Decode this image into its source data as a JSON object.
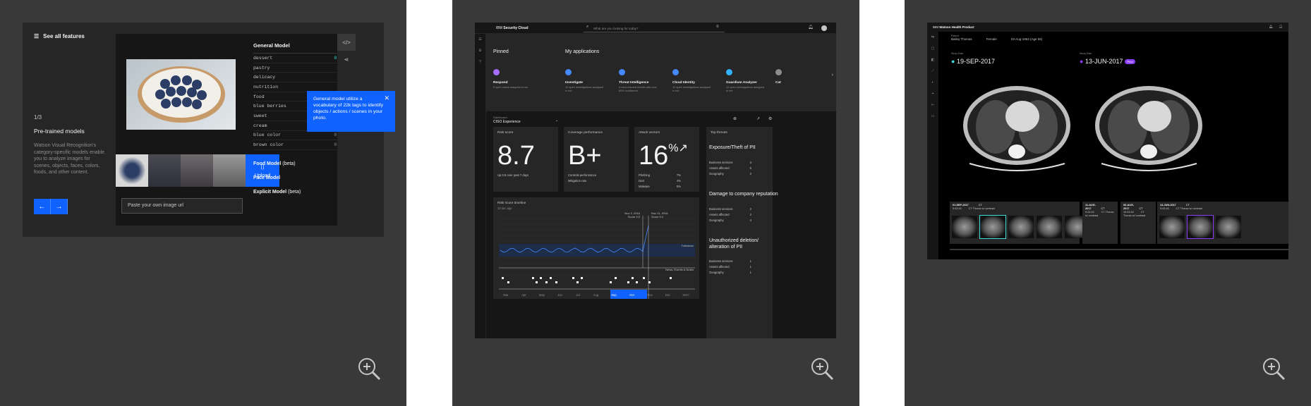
{
  "pane1": {
    "see_all": "See all features",
    "counter": "1/3",
    "title": "Pre-trained models",
    "description": "Watson Visual Recognition's category-specific models enable you to analyze images for scenes, objects, faces, colors, foods, and other content.",
    "upload_label": "Upload",
    "url_placeholder": "Paste your own image url",
    "general_model": "General Model",
    "tags": [
      {
        "name": "dessert",
        "score": "0.99"
      },
      {
        "name": "pastry",
        "score": ""
      },
      {
        "name": "delicacy",
        "score": ""
      },
      {
        "name": "nutrition",
        "score": ""
      },
      {
        "name": "food",
        "score": ""
      },
      {
        "name": "blue berries",
        "score": ""
      },
      {
        "name": "sweet",
        "score": "0.54"
      },
      {
        "name": "cream",
        "score": "0.53"
      },
      {
        "name": "blue color",
        "score": "0.54"
      },
      {
        "name": "brown color",
        "score": "0.54"
      }
    ],
    "food_model": "Food Model",
    "explicit_model": "Explicit Model",
    "face_model": "Face Model",
    "beta": "(beta)",
    "tooltip": "General model utilize a vocabulary of 22k tags to identify objects / actions / scenes in your photo."
  },
  "pane2": {
    "brand_prefix": "IBM",
    "brand": "Security Cloud",
    "search_placeholder": "What are you looking for today?",
    "pinned": "Pinned",
    "my_apps": "My applications",
    "apps": [
      {
        "name": "Respond",
        "desc": "5 open cases assigned to me",
        "color": "#a56eff"
      },
      {
        "name": "Investigate",
        "desc": "12 open investigations assigned to me",
        "color": "#4589ff"
      },
      {
        "name": "Threat Intelligence",
        "desc": "A new relevant threats with over 80% confidence",
        "color": "#4589ff"
      },
      {
        "name": "Cloud Identity",
        "desc": "12 open investigations assigned to me",
        "color": "#4589ff"
      },
      {
        "name": "Guardium Analyzer",
        "desc": "12 open investigations assigned to me",
        "color": "#33b1ff"
      },
      {
        "name": "Cat",
        "desc": "",
        "color": "#8d8d8d"
      }
    ],
    "dashboard_label": "Dashboard",
    "dashboard_name": "CISO Experience",
    "risk_score_label": "Risk score",
    "risk_score": "8.7",
    "risk_sub": "Up 0.6 over past 7 days",
    "coverage_label": "Coverage performance",
    "coverage_grade": "B+",
    "controls": "Controls performance",
    "mitigation": "Mitigation rate",
    "attack_label": "Attack vectors",
    "attack_pct": "16",
    "attack_rows": [
      {
        "name": "Phishing",
        "val": "7%"
      },
      {
        "name": "DoS",
        "val": "4%"
      },
      {
        "name": "Malware",
        "val": "5%"
      }
    ],
    "timeline_label": "Risk score timeline",
    "timeline_sub": "10 sec ago",
    "marker1": "Nov 2, 2016",
    "marker1_score": "Score 3.5",
    "marker2": "Nov 11, 2016",
    "marker2_score": "Score 9.2",
    "tolerance": "Tolerance",
    "news": "News, Events & Notes",
    "months": [
      "Mar",
      "Apr",
      "May",
      "Jun",
      "Jul",
      "Aug",
      "Sep",
      "Oct",
      "Nov",
      "Dec",
      "2017"
    ],
    "top_threats": "Top threats",
    "threats": [
      {
        "title": "Exposure/Theft of PII",
        "bs": "3",
        "aa": "5",
        "geo": "2"
      },
      {
        "title": "Damage to company reputation",
        "bs": "2",
        "aa": "2",
        "geo": "4"
      },
      {
        "title": "Unauthorized deletion/ alteration of PII",
        "bs": "1",
        "aa": "1",
        "geo": "1"
      }
    ],
    "kv_labels": {
      "bs": "Business services",
      "aa": "Assets affected",
      "geo": "Geography"
    }
  },
  "pane3": {
    "brand_prefix": "IBM",
    "brand": "Watson Health Product",
    "patient_label": "Patient",
    "patient_name": "Bailey Thomas",
    "sex": "Female",
    "dob": "03-Aug-1963 (Age 56)",
    "study_label": "Study Date",
    "study1": "19-SEP-2017",
    "study2": "13-JUN-2017",
    "prior": "Prior",
    "series": [
      {
        "date": "01-SEP-2017",
        "time": "9:43:16",
        "mod": "CT",
        "desc": "CT Thorax w/ contrast"
      },
      {
        "date": "11-AUG-2017",
        "time": "9:43:16",
        "mod": "CT",
        "desc": "CT Thorax w/ contrast"
      },
      {
        "date": "06-AUG-2017",
        "time": "10:43:16",
        "mod": "CT",
        "desc": "CT Thorax w/ contrast"
      },
      {
        "date": "13-JUN-2017",
        "time": "9:43:16",
        "mod": "CT",
        "desc": "CT Thorax w/ contrast"
      }
    ]
  }
}
